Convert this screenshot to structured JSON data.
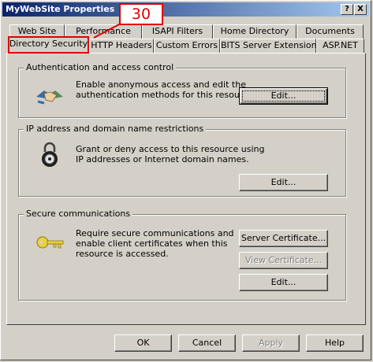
{
  "window": {
    "title": "MyWebSite Properties",
    "help_glyph": "?",
    "close_glyph": "X"
  },
  "tabs_row1": [
    "Web Site",
    "Performance",
    "ISAPI Filters",
    "Home Directory",
    "Documents"
  ],
  "tabs_row2": [
    "Directory Security",
    "HTTP Headers",
    "Custom Errors",
    "BITS Server Extension",
    "ASP.NET"
  ],
  "active_tab": "Directory Security",
  "callout": {
    "label": "30",
    "color": "#e00000"
  },
  "auth": {
    "title": "Authentication and access control",
    "description_line1": "Enable anonymous access and edit the",
    "description_line2": "authentication methods for this resource.",
    "edit_button": "Edit..."
  },
  "ip": {
    "title": "IP address and domain name restrictions",
    "description_line1": "Grant or deny access to this resource using",
    "description_line2": "IP addresses or Internet domain names.",
    "edit_button": "Edit..."
  },
  "secure": {
    "title": "Secure communications",
    "description_line1": "Require secure communications and",
    "description_line2": "enable client certificates when this",
    "description_line3": "resource is accessed.",
    "server_cert_button": "Server Certificate...",
    "view_cert_button": "View Certificate...",
    "edit_button": "Edit..."
  },
  "footer": {
    "ok": "OK",
    "cancel": "Cancel",
    "apply": "Apply",
    "help": "Help"
  }
}
